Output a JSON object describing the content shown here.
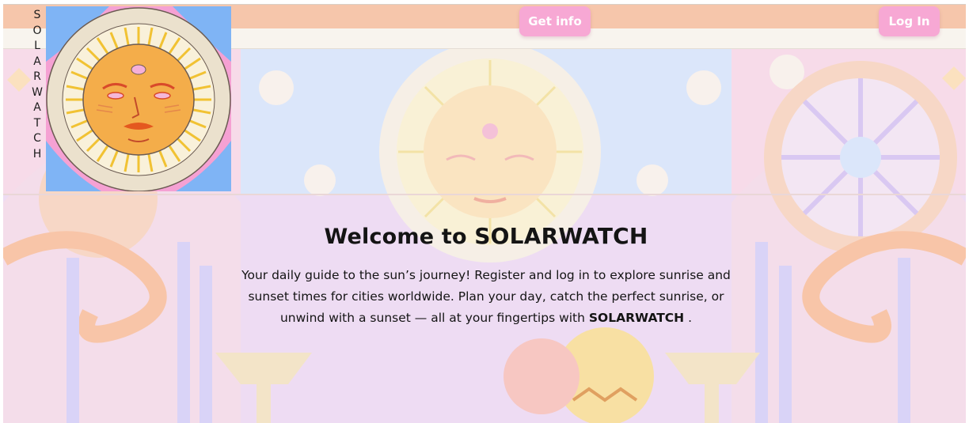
{
  "brand": {
    "vertical_letters": [
      "S",
      "O",
      "L",
      "A",
      "R",
      "W",
      "A",
      "T",
      "C",
      "H"
    ]
  },
  "header": {
    "get_info_label": "Get info",
    "login_label": "Log In"
  },
  "hero": {
    "title_prefix": "Welcome to ",
    "title_brand": "SOLARWATCH",
    "paragraph_text": "Your daily guide to the sun’s journey! Register and log in to explore sunrise and sunset times for cities worldwide. Plan your day, catch the perfect sunrise, or unwind with a sunset — all at your fingertips with ",
    "paragraph_brand": "SOLARWATCH",
    "paragraph_end": " ."
  },
  "colors": {
    "button_bg": "#f7a8d4",
    "header_band": "#f6c6ab",
    "subheader_band": "#f8f4ee"
  }
}
